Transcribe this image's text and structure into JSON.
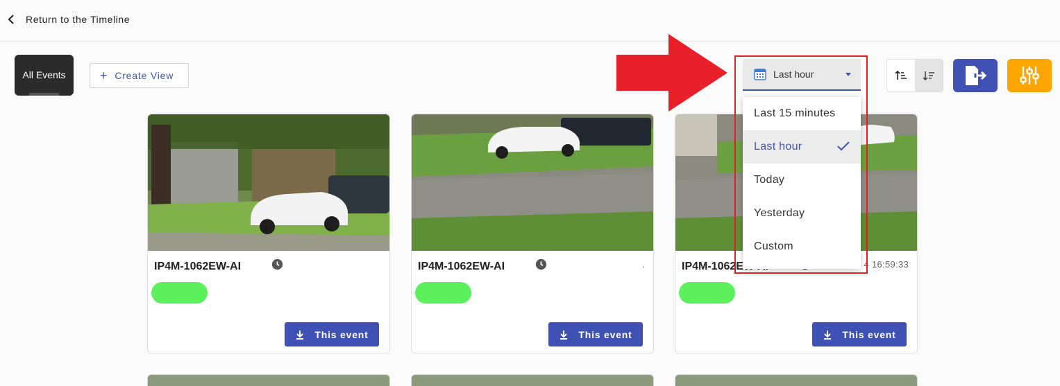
{
  "header": {
    "back_label": "Return to the Timeline"
  },
  "toolbar": {
    "all_events_label": "All Events",
    "create_view_label": "Create View",
    "create_view_icon": "plus-icon",
    "period_select": {
      "value": "Last hour",
      "icon": "calendar-icon"
    },
    "period_options": [
      {
        "label": "Last 15 minutes",
        "selected": false
      },
      {
        "label": "Last hour",
        "selected": true
      },
      {
        "label": "Today",
        "selected": false
      },
      {
        "label": "Yesterday",
        "selected": false
      },
      {
        "label": "Custom",
        "selected": false
      }
    ],
    "sort_buttons": [
      "sort-ascending-icon",
      "sort-descending-icon"
    ],
    "export_icon": "export-icon",
    "settings_icon": "sliders-icon",
    "colors": {
      "primary": "#3f51b5",
      "settings": "#ffa500",
      "highlight": "#e02020",
      "tag": "#5df05d"
    }
  },
  "cards": [
    {
      "camera": "IP4M-1062EW-AI",
      "meta": "",
      "download_label": "This event"
    },
    {
      "camera": "IP4M-1062EW-AI",
      "meta": ".",
      "download_label": "This event"
    },
    {
      "camera": "IP4M-1062EW-AI",
      "meta": "4 16:59:33",
      "download_label": "This event"
    }
  ]
}
